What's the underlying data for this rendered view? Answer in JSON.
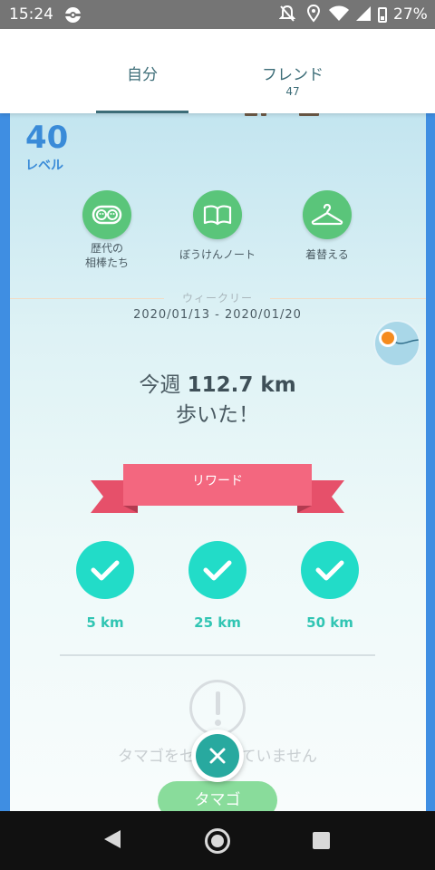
{
  "status_bar": {
    "time": "15:24",
    "battery": "27%",
    "icons": [
      "pokemon-go-notification-icon",
      "mute-icon",
      "location-icon",
      "wifi-icon",
      "signal-icon",
      "battery-icon"
    ]
  },
  "tabs": {
    "self_label": "自分",
    "friend_label": "フレンド",
    "friend_count": "47"
  },
  "profile": {
    "level": "40",
    "level_label": "レベル"
  },
  "actions": [
    {
      "label_line1": "歴代の",
      "label_line2": "相棒たち",
      "icon": "buddy-history-icon"
    },
    {
      "label_line1": "ぼうけんノート",
      "label_line2": "",
      "icon": "journal-book-icon"
    },
    {
      "label_line1": "着替える",
      "label_line2": "",
      "icon": "hanger-icon"
    }
  ],
  "weekly": {
    "title": "ウィークリー",
    "dates": "2020/01/13 - 2020/01/20",
    "walked_prefix": "今週 ",
    "walked_value": "112.7 km",
    "walked_suffix": "歩いた！"
  },
  "rewards": {
    "label": "リワード",
    "milestones": [
      "5 km",
      "25 km",
      "50 km"
    ],
    "completed": [
      true,
      true,
      true
    ]
  },
  "egg": {
    "empty_text": "タマゴをセットしていません",
    "button_label": "タマゴ"
  },
  "colors": {
    "accent_blue": "#3a8bd8",
    "tab_teal": "#3d6d78",
    "action_green": "#5ac57a",
    "ribbon_pink": "#f0607a",
    "check_teal": "#22dcc8",
    "close_teal": "#28a99f"
  }
}
